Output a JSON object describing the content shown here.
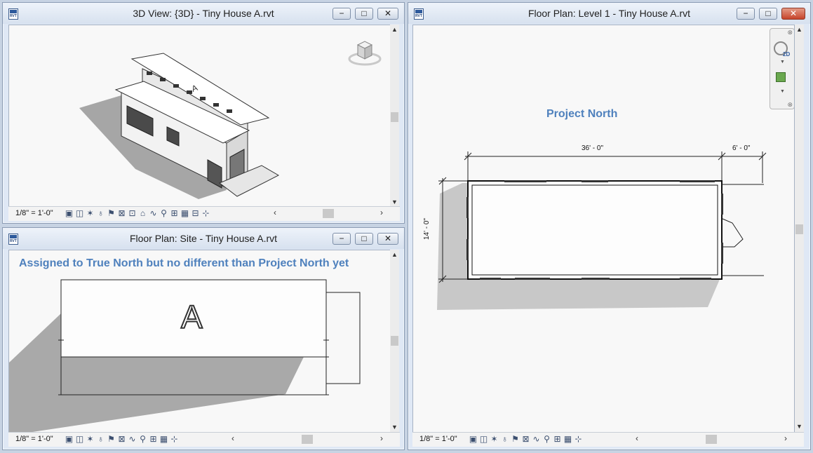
{
  "windows": {
    "view3d": {
      "title": "3D View: {3D} - Tiny House A.rvt",
      "scale": "1/8\" = 1'-0\""
    },
    "site": {
      "title": "Floor Plan: Site - Tiny House A.rvt",
      "scale": "1/8\" = 1'-0\"",
      "annotation": "Assigned to True North but no different than Project North yet",
      "building_label": "A"
    },
    "level1": {
      "title": "Floor Plan: Level 1 - Tiny House A.rvt",
      "scale": "1/8\" = 1'-0\"",
      "annotation": "Project North",
      "dim_length": "36' - 0\"",
      "dim_ext": "6' - 0\"",
      "dim_width": "14' - 0\"",
      "nav_2d": "2D"
    }
  },
  "controls": {
    "minimize": "−",
    "maximize": "□",
    "close": "✕"
  },
  "view_icons": [
    "▣",
    "◫",
    "✶",
    "♁",
    "⚑",
    "⊠",
    "⊡",
    "⌂",
    "∿",
    "⚲",
    "⊞",
    "▦",
    "⊟",
    "⊹"
  ],
  "nav": {
    "left": "‹",
    "right": "›",
    "up": "▲",
    "down": "▼"
  },
  "colors": {
    "annotation": "#4f81bd",
    "close": "#c6442b"
  }
}
